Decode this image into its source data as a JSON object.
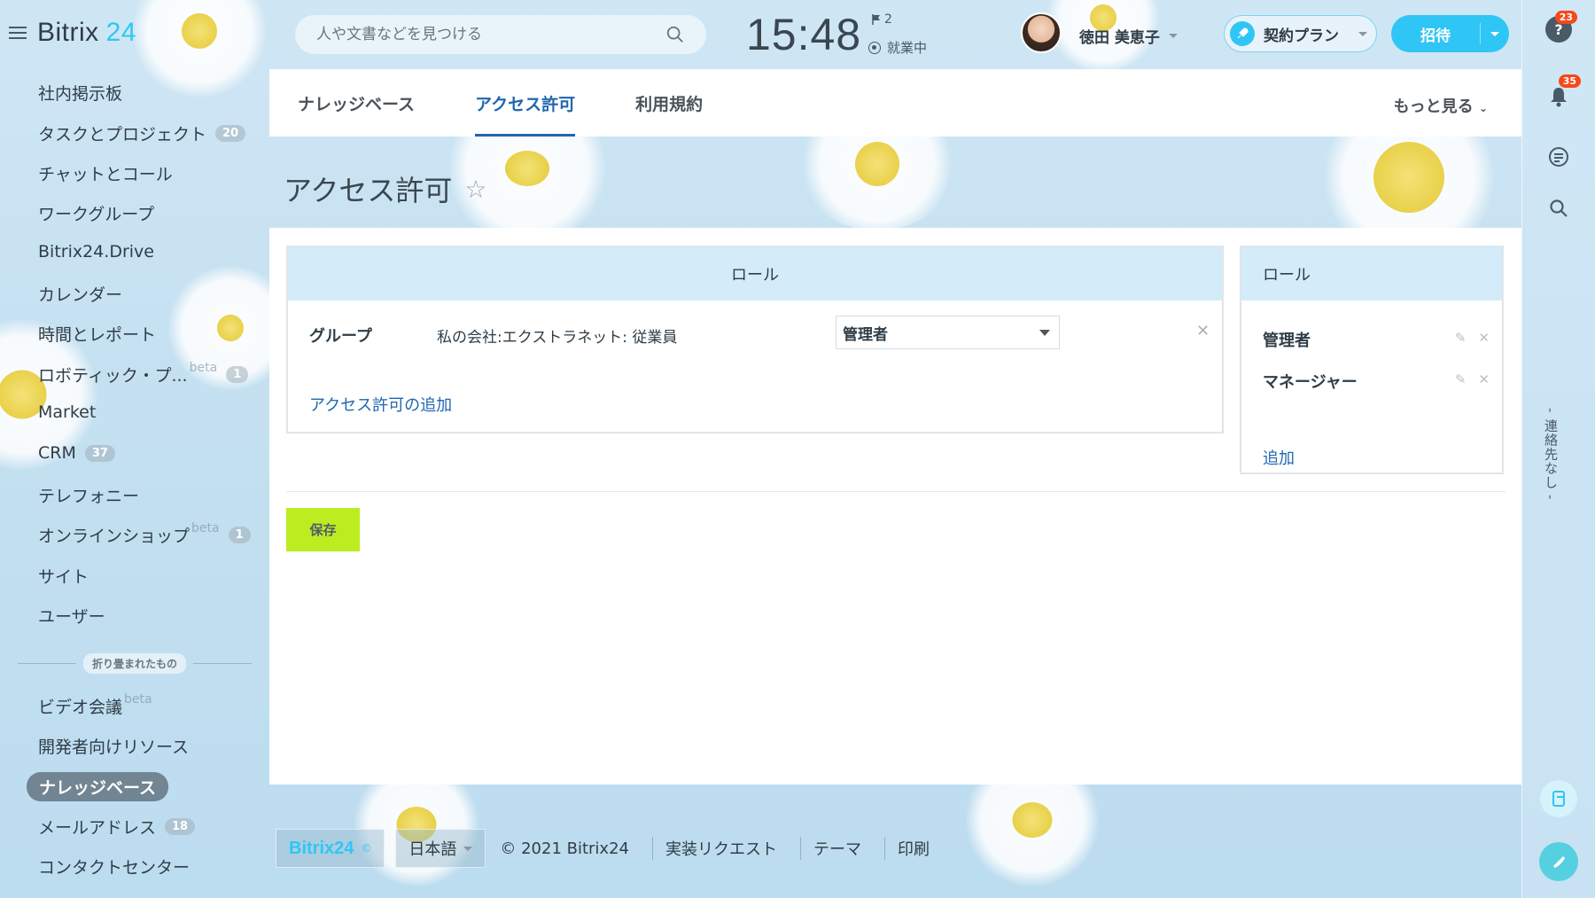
{
  "app": {
    "logo_text": "Bitrix",
    "logo_num": "24"
  },
  "header": {
    "search_placeholder": "人や文書などを見つける",
    "time": "15:48",
    "flag_count": "2",
    "work_status": "就業中",
    "user_name": "徳田 美恵子",
    "plan_label": "契約プラン",
    "invite_label": "招待"
  },
  "sidebar": {
    "items": [
      {
        "label": "社内掲示板"
      },
      {
        "label": "タスクとプロジェクト",
        "badge": "20"
      },
      {
        "label": "チャットとコール"
      },
      {
        "label": "ワークグループ"
      },
      {
        "label": "Bitrix24.Drive"
      },
      {
        "label": "カレンダー"
      },
      {
        "label": "時間とレポート"
      },
      {
        "label": "ロボティック・プ...",
        "beta": "beta",
        "badge": "1"
      },
      {
        "label": "Market"
      },
      {
        "label": "CRM",
        "badge": "37"
      },
      {
        "label": "テレフォニー"
      },
      {
        "label": "オンラインショップ",
        "beta": "beta",
        "badge": "1"
      },
      {
        "label": "サイト"
      },
      {
        "label": "ユーザー"
      }
    ],
    "folded_label": "折り畳まれたもの",
    "folded_items": [
      {
        "label": "ビデオ会議",
        "beta": "beta"
      },
      {
        "label": "開発者向けリソース"
      },
      {
        "label": "ナレッジベース"
      },
      {
        "label": "メールアドレス",
        "badge": "18"
      },
      {
        "label": "コンタクトセンター"
      }
    ]
  },
  "tabs": [
    {
      "label": "ナレッジベース"
    },
    {
      "label": "アクセス許可"
    },
    {
      "label": "利用規約"
    }
  ],
  "more_label": "もっと見る",
  "page_title": "アクセス許可",
  "permissions": {
    "header": "ロール",
    "row": {
      "type": "グループ",
      "name": "私の会社:エクストラネット: 従業員",
      "role": "管理者"
    },
    "add_link": "アクセス許可の追加"
  },
  "roles": {
    "header": "ロール",
    "items": [
      "管理者",
      "マネージャー"
    ],
    "add_link": "追加"
  },
  "save_label": "保存",
  "footer": {
    "brand": "Bitrix24",
    "language": "日本語",
    "copyright": "© 2021 Bitrix24",
    "links": [
      "実装リクエスト",
      "テーマ",
      "印刷"
    ]
  },
  "rightbar": {
    "help_badge": "23",
    "notify_badge": "35",
    "vertical_text": "- 連絡先なし -"
  },
  "colors": {
    "accent": "#2fc6f6",
    "link": "#2067b0",
    "save": "#bbed21",
    "badge_red": "#f54819"
  }
}
